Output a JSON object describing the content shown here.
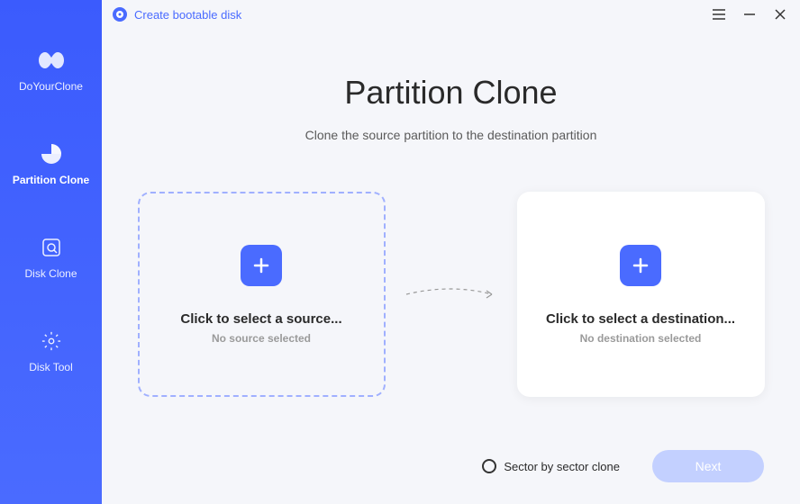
{
  "titlebar": {
    "create_bootable": "Create bootable disk"
  },
  "sidebar": {
    "items": [
      {
        "label": "DoYourClone"
      },
      {
        "label": "Partition Clone"
      },
      {
        "label": "Disk Clone"
      },
      {
        "label": "Disk Tool"
      }
    ]
  },
  "page": {
    "title": "Partition Clone",
    "subtitle": "Clone the source partition to the destination partition"
  },
  "source_card": {
    "title": "Click to select a source...",
    "subtitle": "No source selected"
  },
  "dest_card": {
    "title": "Click to select a destination...",
    "subtitle": "No destination selected"
  },
  "footer": {
    "sector_label": "Sector by sector clone",
    "next_label": "Next"
  }
}
